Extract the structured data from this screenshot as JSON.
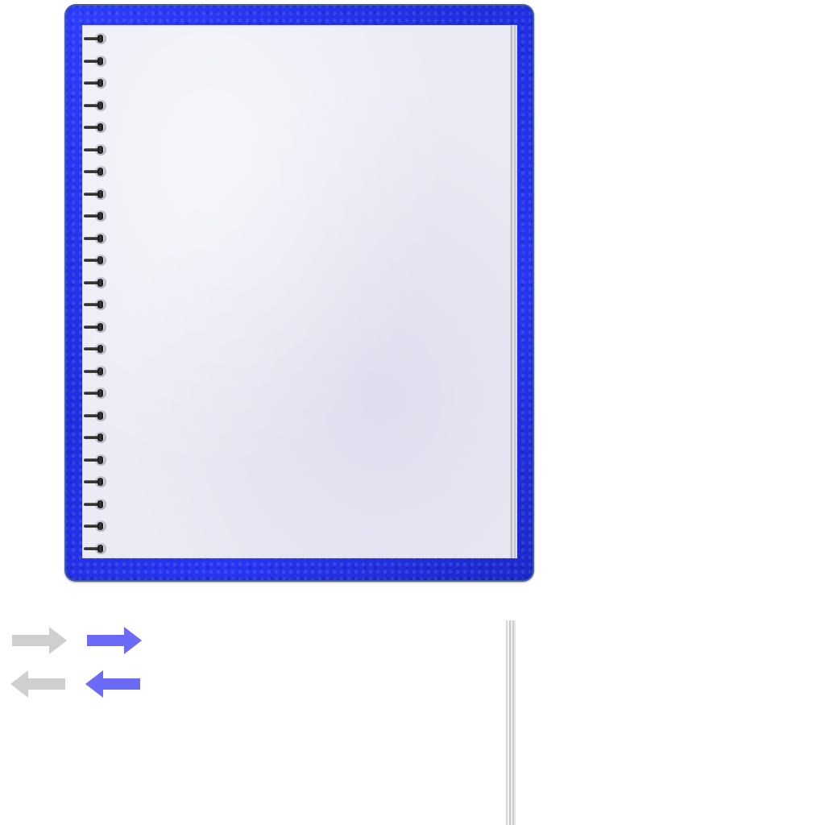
{
  "notebook": {
    "cover_color": "#2332f0",
    "paper_color": "#ebebf5",
    "ring_count": 24
  },
  "controls": {
    "next_disabled": {
      "icon": "arrow-right-icon",
      "color": "#cfcfcf"
    },
    "next_active": {
      "icon": "arrow-right-icon",
      "color": "#6b6bf7"
    },
    "prev_disabled": {
      "icon": "arrow-left-icon",
      "color": "#cfcfcf"
    },
    "prev_active": {
      "icon": "arrow-left-icon",
      "color": "#6b6bf7"
    }
  }
}
